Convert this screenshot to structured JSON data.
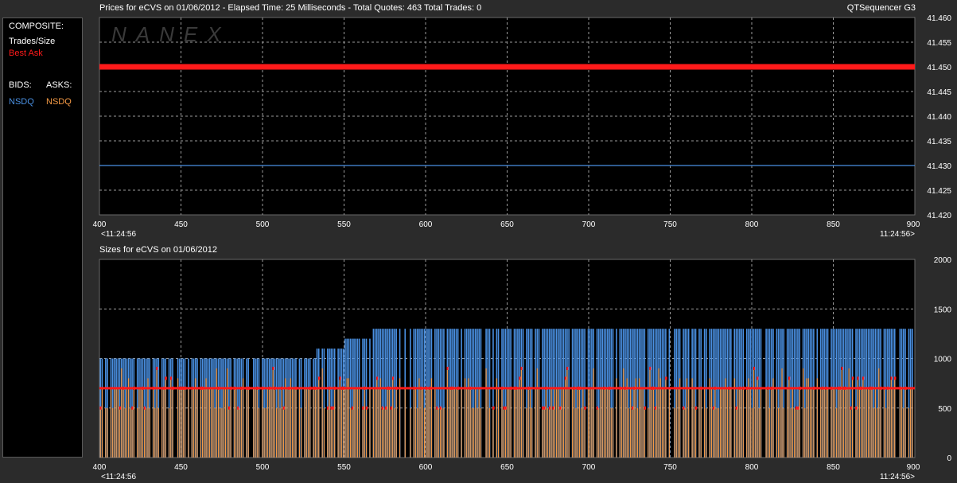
{
  "header": {
    "title": "Prices for  eCVS  on  01/06/2012  -  Elapsed Time: 25 Milliseconds  -  Total Quotes: 463  Total Trades: 0",
    "app_name": "QTSequencer G3",
    "sizes_title": "Sizes for  eCVS  on  01/06/2012"
  },
  "legend": {
    "composite_label": "COMPOSITE:",
    "trades_size_label": "Trades/Size",
    "best_ask_label": "Best Ask",
    "bids_label": "BIDS:",
    "asks_label": "ASKS:",
    "bid_exchange": "NSDQ",
    "ask_exchange": "NSDQ"
  },
  "watermark": "NANEX",
  "time_start": "<11:24:56",
  "time_end": "11:24:56>",
  "colors": {
    "background": "#000000",
    "best_ask": "#ff1a1a",
    "bid": "#4a90e2",
    "ask": "#f59a45",
    "grid": "#9a9a9a"
  },
  "chart_data": [
    {
      "type": "line",
      "title": "Prices for  eCVS  on  01/06/2012",
      "xlim": [
        400,
        900
      ],
      "ylim": [
        41.42,
        41.46
      ],
      "x_ticks": [
        400,
        450,
        500,
        550,
        600,
        650,
        700,
        750,
        800,
        850,
        900
      ],
      "y_ticks": [
        "41.420",
        "41.425",
        "41.430",
        "41.435",
        "41.440",
        "41.445",
        "41.450",
        "41.455",
        "41.460"
      ],
      "grid": true,
      "series": [
        {
          "name": "Best Ask",
          "x": [
            400,
            900
          ],
          "y": [
            41.45,
            41.45
          ]
        },
        {
          "name": "NSDQ",
          "x": [
            400,
            900
          ],
          "y": [
            41.43,
            41.43
          ]
        }
      ]
    },
    {
      "type": "bar",
      "title": "Sizes for  eCVS  on  01/06/2012",
      "xlim": [
        400,
        900
      ],
      "ylim": [
        0,
        2000
      ],
      "x_ticks": [
        400,
        450,
        500,
        550,
        600,
        650,
        700,
        750,
        800,
        850,
        900
      ],
      "y_ticks": [
        "0",
        "500",
        "1000",
        "1500",
        "2000"
      ],
      "grid": true,
      "bid_size_steps": [
        {
          "from": 400,
          "to": 510,
          "value": 1000
        },
        {
          "from": 510,
          "to": 533,
          "value": 1000
        },
        {
          "from": 533,
          "to": 550,
          "value": 1100
        },
        {
          "from": 550,
          "to": 558,
          "value": 1200
        },
        {
          "from": 558,
          "to": 566,
          "value": 1200
        },
        {
          "from": 566,
          "to": 900,
          "value": 1300
        }
      ],
      "ask_size_levels": [
        500,
        700,
        800,
        900
      ],
      "ask_size_typical": 700
    }
  ]
}
